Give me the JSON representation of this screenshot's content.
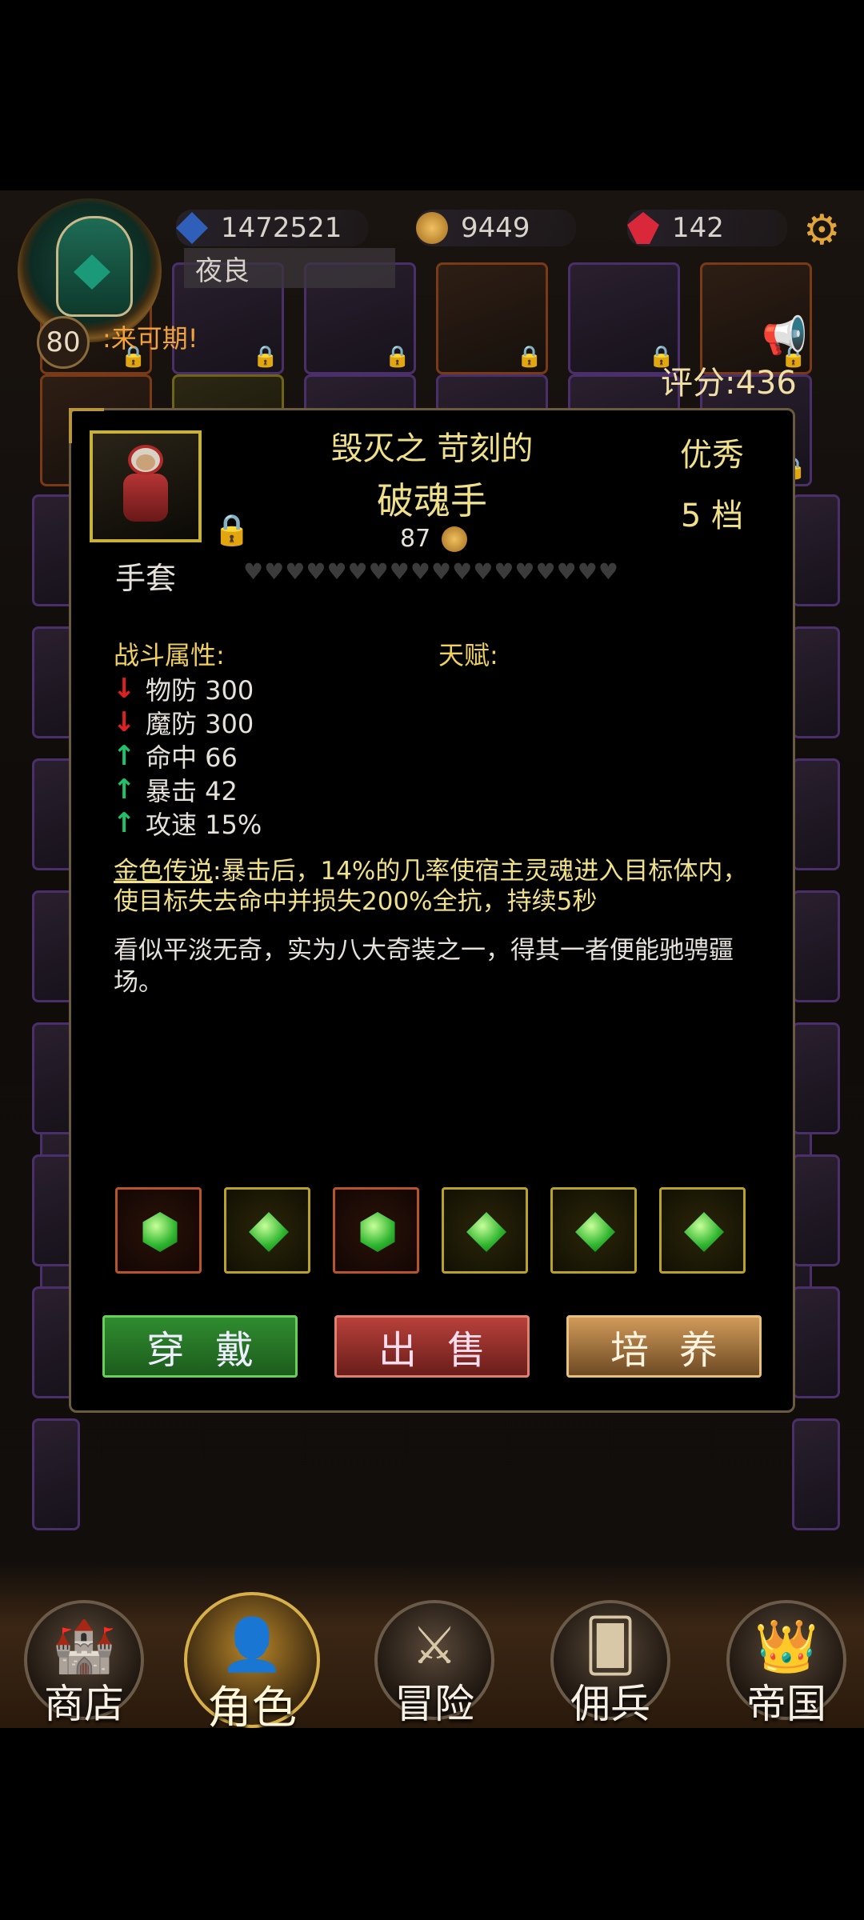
{
  "header": {
    "resources": [
      {
        "name": "sapphire",
        "value": "1472521"
      },
      {
        "name": "gold",
        "value": "9449"
      },
      {
        "name": "ruby",
        "value": "142"
      }
    ],
    "player_name": "夜良",
    "level": "80",
    "marquee": ":来可期!",
    "score": "评分:436"
  },
  "item": {
    "prefix": "毁灭之 苛刻的",
    "name": "破魂手",
    "price": "87",
    "quality": "优秀",
    "tier": "5 档",
    "type": "手套",
    "heart_count": 18
  },
  "combat": {
    "title": "战斗属性:",
    "talent_title": "天赋:",
    "attributes": [
      {
        "label": "物防 300",
        "trend": "down"
      },
      {
        "label": "魔防 300",
        "trend": "down"
      },
      {
        "label": "命中 66",
        "trend": "up"
      },
      {
        "label": "暴击 42",
        "trend": "up"
      },
      {
        "label": "攻速 15%",
        "trend": "up"
      }
    ]
  },
  "legend": {
    "title": "金色传说",
    "text": ":暴击后，14%的几率使宿主灵魂进入目标体内，使目标失去命中并损失200%全抗，持续5秒"
  },
  "lore": "看似平淡无奇，实为八大奇装之一，得其一者便能驰骋疆场。",
  "gems": [
    {
      "frame": "orange",
      "shape": "hex"
    },
    {
      "frame": "gold",
      "shape": "diamond"
    },
    {
      "frame": "orange",
      "shape": "hex"
    },
    {
      "frame": "gold",
      "shape": "diamond"
    },
    {
      "frame": "gold",
      "shape": "diamond"
    },
    {
      "frame": "gold",
      "shape": "diamond"
    }
  ],
  "buttons": {
    "wear": "穿戴",
    "sell": "出售",
    "train": "培养"
  },
  "nav": [
    {
      "label": "商店",
      "icon": "castle-icon"
    },
    {
      "label": "角色",
      "icon": "hooded-character-icon"
    },
    {
      "label": "冒险",
      "icon": "crossed-swords-icon"
    },
    {
      "label": "佣兵",
      "icon": "mercenary-card-icon"
    },
    {
      "label": "帝国",
      "icon": "crown-icon"
    }
  ],
  "colors": {
    "gold_text": "#f0e08a",
    "rarity_purple": "#4a2f6a",
    "wear_green": "#2f8c2f",
    "sell_red": "#b8403a",
    "train_bronze": "#d09a5a"
  }
}
